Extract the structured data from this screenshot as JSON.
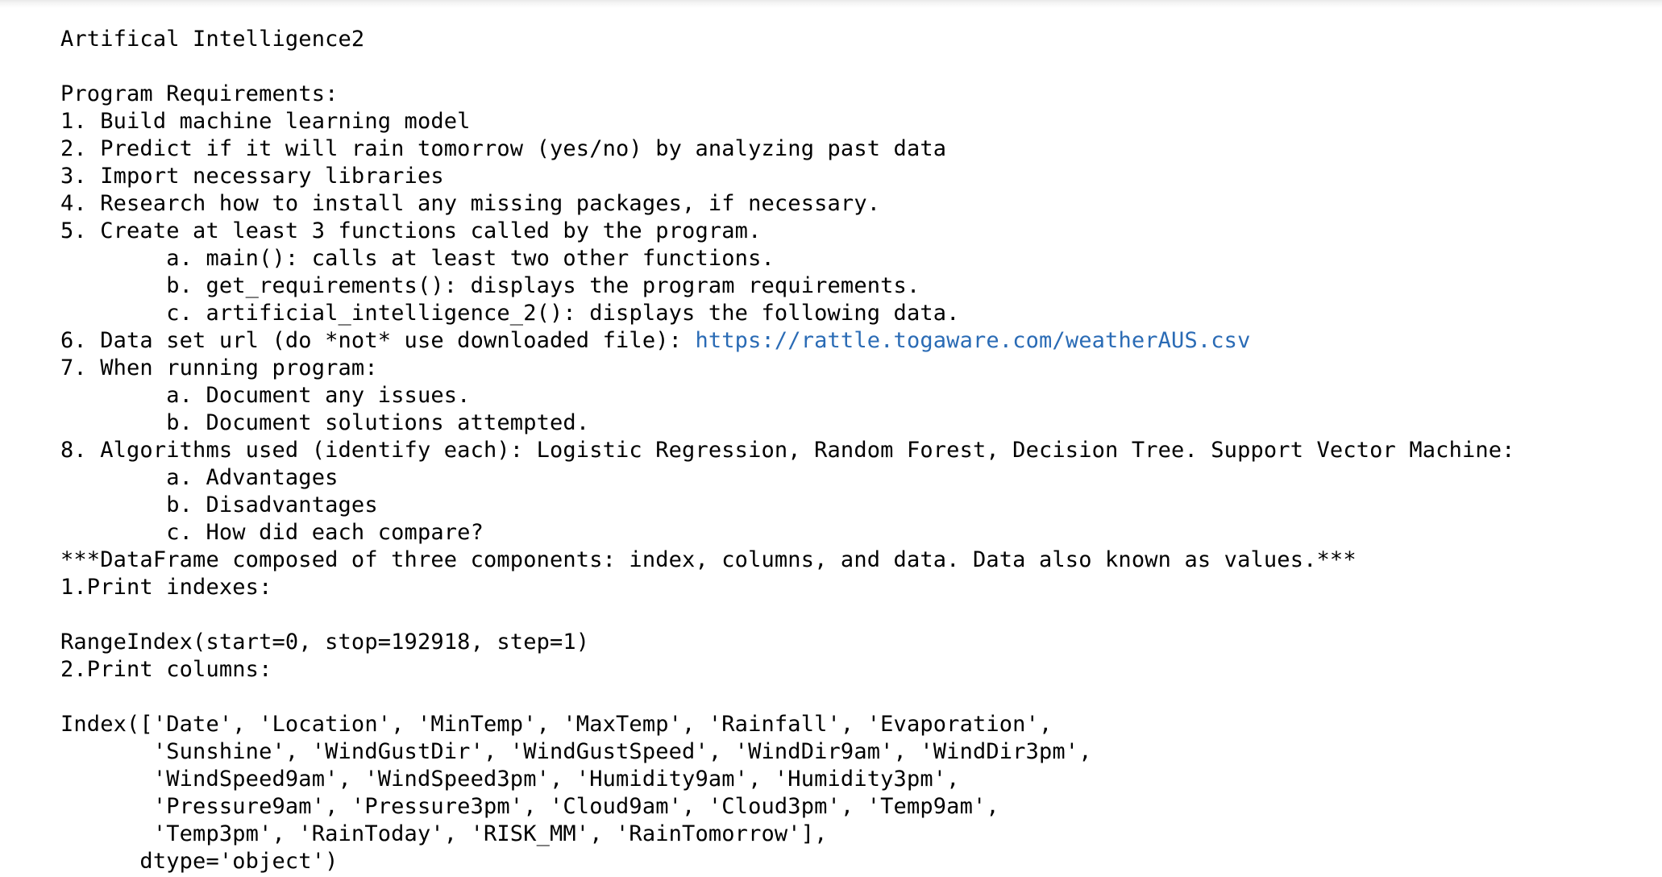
{
  "output": {
    "lines": [
      "Artifical Intelligence2",
      "",
      "Program Requirements:",
      "1. Build machine learning model",
      "2. Predict if it will rain tomorrow (yes/no) by analyzing past data",
      "3. Import necessary libraries",
      "4. Research how to install any missing packages, if necessary.",
      "5. Create at least 3 functions called by the program.",
      "\ta. main(): calls at least two other functions.",
      "\tb. get_requirements(): displays the program requirements.",
      "\tc. artificial_intelligence_2(): displays the following data.",
      "",
      "7. When running program:",
      "\ta. Document any issues.",
      "\tb. Document solutions attempted.",
      "8. Algorithms used (identify each): Logistic Regression, Random Forest, Decision Tree. Support Vector Machine:",
      "\ta. Advantages",
      "\tb. Disadvantages",
      "\tc. How did each compare?",
      "***DataFrame composed of three components: index, columns, and data. Data also known as values.***",
      "1.Print indexes:",
      "",
      "RangeIndex(start=0, stop=192918, step=1)",
      "2.Print columns:",
      "",
      "Index(['Date', 'Location', 'MinTemp', 'MaxTemp', 'Rainfall', 'Evaporation',",
      "       'Sunshine', 'WindGustDir', 'WindGustSpeed', 'WindDir9am', 'WindDir3pm',",
      "       'WindSpeed9am', 'WindSpeed3pm', 'Humidity9am', 'Humidity3pm',",
      "       'Pressure9am', 'Pressure3pm', 'Cloud9am', 'Cloud3pm', 'Temp9am',",
      "       'Temp3pm', 'RainToday', 'RISK_MM', 'RainTomorrow'],",
      "      dtype='object')"
    ],
    "dataset_line_prefix": "6. Data set url (do *not* use downloaded file): ",
    "dataset_url": "https://rattle.togaware.com/weatherAUS.csv"
  },
  "colors": {
    "text": "#000000",
    "link": "#2a6bb5",
    "background": "#ffffff"
  }
}
